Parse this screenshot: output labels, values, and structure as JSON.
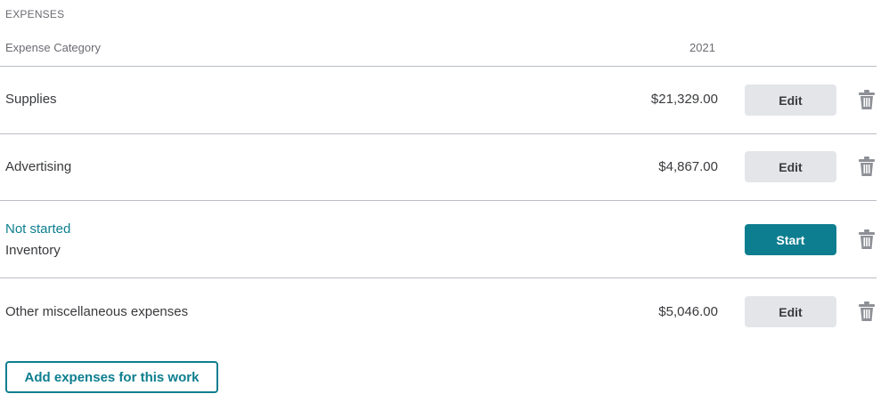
{
  "section": {
    "title": "EXPENSES"
  },
  "table": {
    "header": {
      "category": "Expense Category",
      "year": "2021"
    },
    "rows": [
      {
        "status": "",
        "label": "Supplies",
        "amount": "$21,329.00",
        "action": "Edit",
        "delete_icon": "trash-icon"
      },
      {
        "status": "",
        "label": "Advertising",
        "amount": "$4,867.00",
        "action": "Edit",
        "delete_icon": "trash-icon"
      },
      {
        "status": "Not started",
        "label": "Inventory",
        "amount": "",
        "action": "Start",
        "delete_icon": "trash-icon"
      },
      {
        "status": "",
        "label": "Other miscellaneous expenses",
        "amount": "$5,046.00",
        "action": "Edit",
        "delete_icon": "trash-icon"
      }
    ]
  },
  "add_button": {
    "label": "Add expenses for this work"
  },
  "colors": {
    "accent": "#0d7e8f",
    "edit_button_bg": "#e3e5e8",
    "text": "#393a3d",
    "muted_text": "#6b6c72",
    "divider": "#babec5",
    "icon": "#8d9096"
  }
}
